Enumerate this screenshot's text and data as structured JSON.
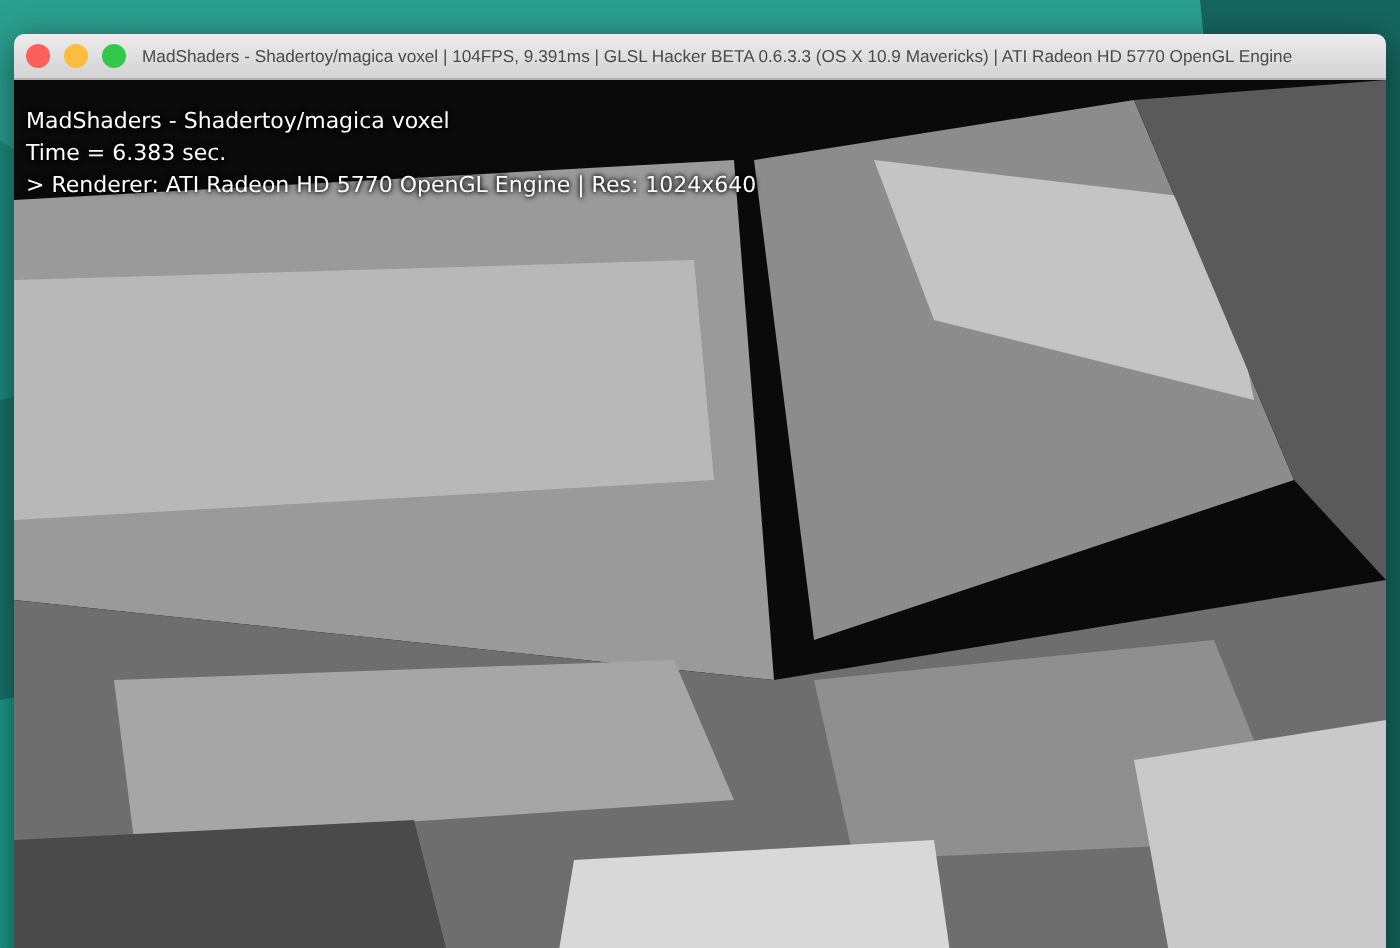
{
  "window": {
    "title": "MadShaders - Shadertoy/magica voxel | 104FPS, 9.391ms | GLSL Hacker BETA 0.6.3.3 (OS X 10.9 Mavericks) | ATI Radeon HD 5770 OpenGL Engine",
    "buttons": [
      {
        "color": "#fc605c"
      },
      {
        "color": "#fdbc40"
      },
      {
        "color": "#34c84a"
      }
    ]
  },
  "viewport": {
    "kind": "picture",
    "overlay_lines": [
      "MadShaders - Shadertoy/magica voxel",
      "Time = 6.383 sec.",
      "> Renderer: ATI Radeon HD 5770 OpenGL Engine | Res: 1024x640"
    ]
  }
}
